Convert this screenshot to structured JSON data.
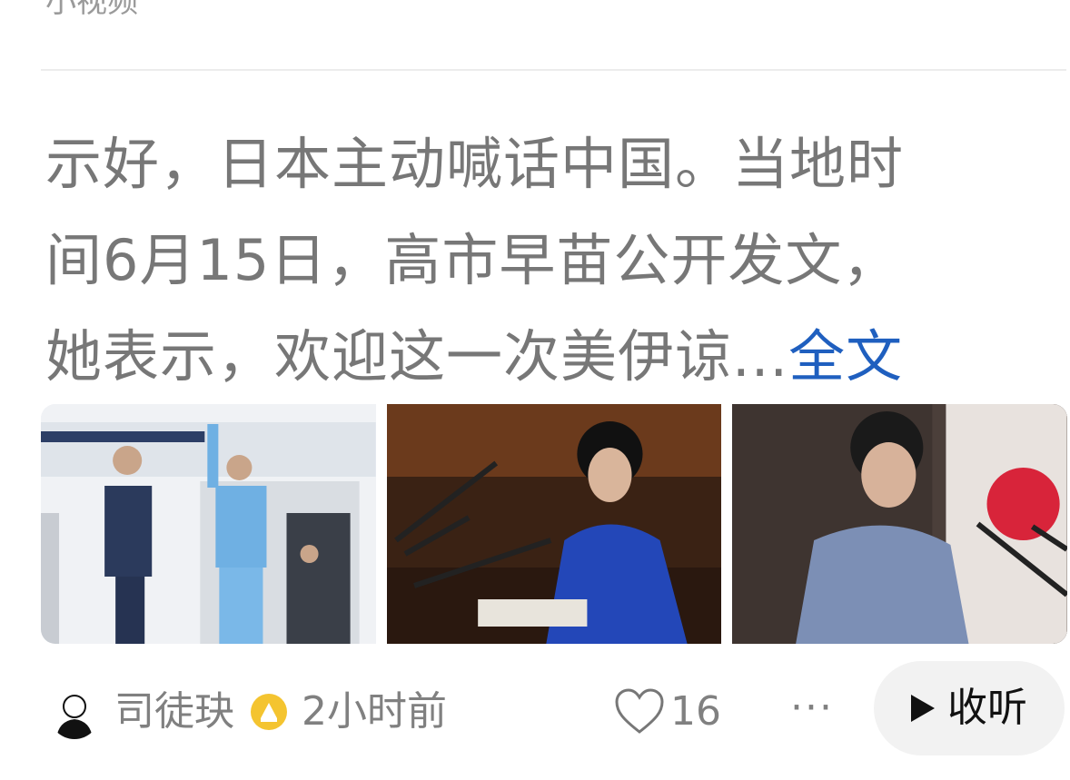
{
  "prev": {
    "title": "小视频"
  },
  "post": {
    "lines": [
      "示好，日本主动喊话中国。当地时",
      "间6月15日，高市早苗公开发文，",
      "她表示，欢迎这一次美伊谅..."
    ],
    "full_link": "全文"
  },
  "footer": {
    "author": "司徒玦",
    "time": "2小时前",
    "likes": "16",
    "more": "···",
    "listen_label": "收听"
  },
  "colors": {
    "text": "#777777",
    "link": "#1f5fbf",
    "badge": "#f4c430"
  },
  "icons": [
    "avatar",
    "verified-badge-icon",
    "heart-icon",
    "more-icon",
    "play-icon"
  ]
}
